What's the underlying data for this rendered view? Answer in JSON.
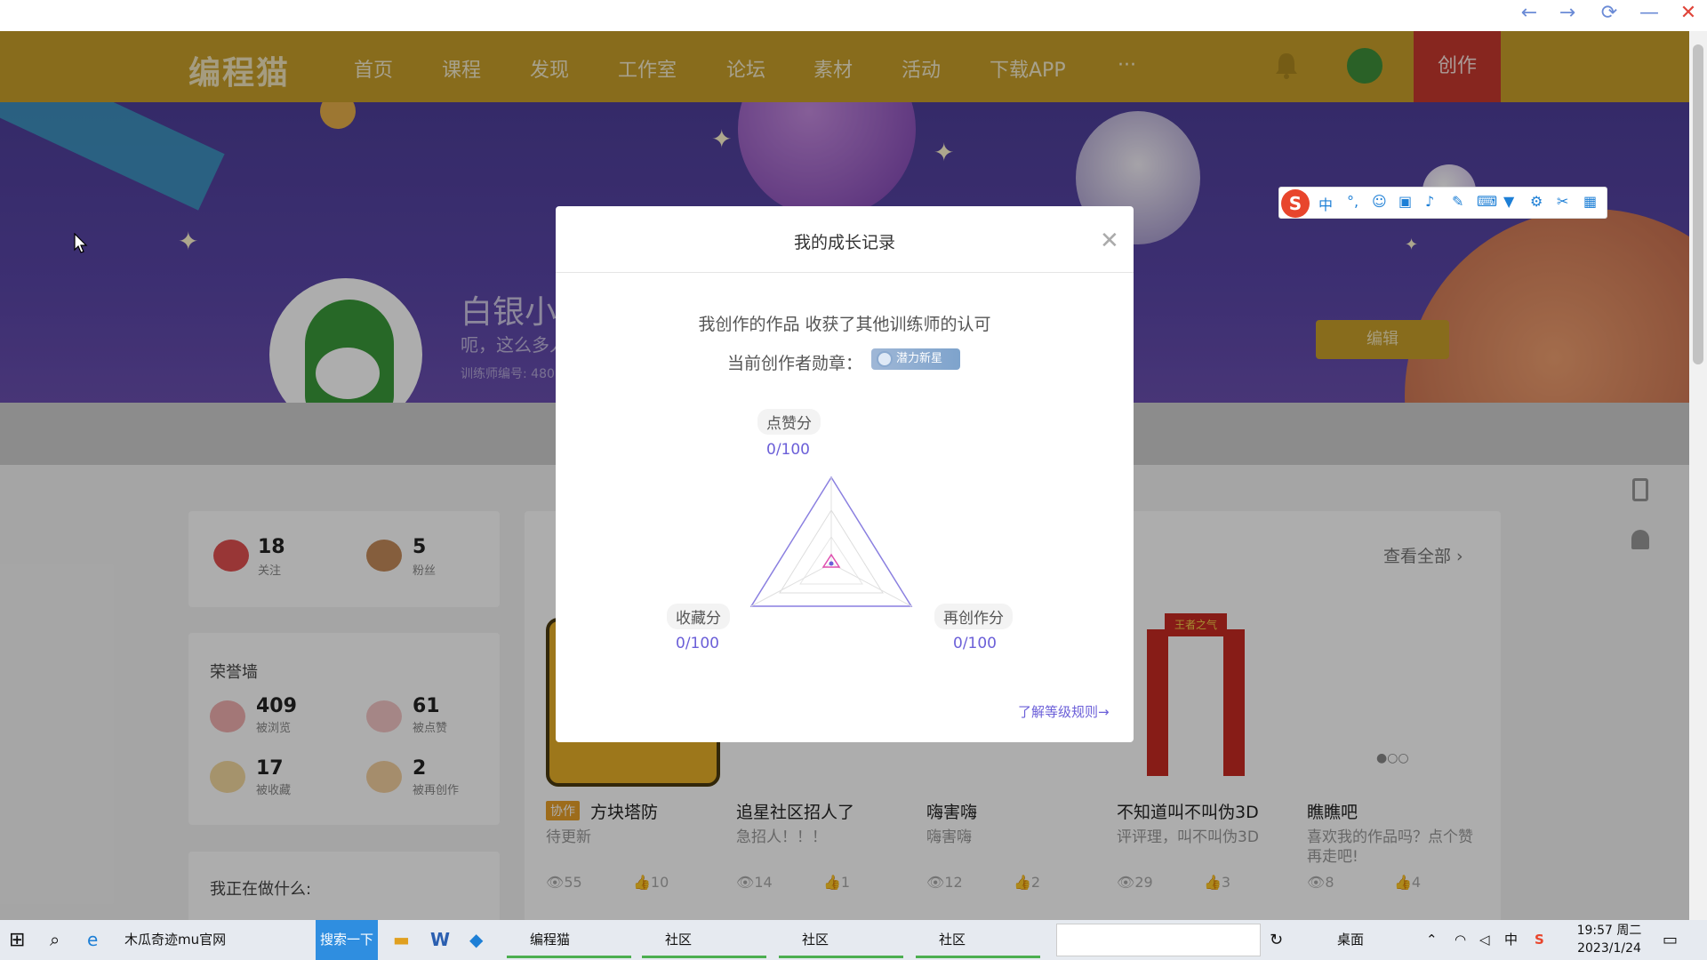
{
  "browser": {
    "back": "←",
    "forward": "→",
    "refresh": "⟳",
    "minimize": "—",
    "close": "✕"
  },
  "nav": {
    "logo": "编程猫",
    "items": [
      "首页",
      "课程",
      "发现",
      "工作室",
      "论坛",
      "素材",
      "活动",
      "下载APP",
      "···"
    ],
    "create": "创作"
  },
  "profile": {
    "name": "白银小弟",
    "subtitle": "呃，这么多人",
    "id_label": "训练师编号: 480",
    "edit": "编辑"
  },
  "stats": {
    "follow": {
      "num": "18",
      "label": "关注"
    },
    "fans": {
      "num": "5",
      "label": "粉丝"
    }
  },
  "honor": {
    "title": "荣誉墙",
    "items": [
      {
        "num": "409",
        "label": "被浏览"
      },
      {
        "num": "61",
        "label": "被点赞"
      },
      {
        "num": "17",
        "label": "被收藏"
      },
      {
        "num": "2",
        "label": "被再创作"
      }
    ]
  },
  "doing": {
    "title": "我正在做什么:"
  },
  "works": {
    "view_all": "查看全部",
    "items": [
      {
        "tag": "协作",
        "title": "方块塔防",
        "sub": "待更新",
        "views": "55",
        "likes": "10"
      },
      {
        "title": "追星社区招人了",
        "sub": "急招人！！！",
        "views": "14",
        "likes": "1"
      },
      {
        "title": "嗨害嗨",
        "sub": "嗨害嗨",
        "views": "12",
        "likes": "2"
      },
      {
        "title": "不知道叫不叫伪3D",
        "sub": "评评理，叫不叫伪3D",
        "views": "29",
        "likes": "3"
      },
      {
        "title": "瞧瞧吧",
        "sub": "喜欢我的作品吗？点个赞",
        "sub2": "再走吧!",
        "views": "8",
        "likes": "4"
      }
    ],
    "poster_text": "王者之气"
  },
  "modal": {
    "title": "我的成长记录",
    "line1": "我创作的作品 收获了其他训练师的认可",
    "line2": "当前创作者勋章：",
    "badge": "潜力新星",
    "radar": {
      "top": {
        "label": "点赞分",
        "value": "0/100"
      },
      "left": {
        "label": "收藏分",
        "value": "0/100"
      },
      "right": {
        "label": "再创作分",
        "value": "0/100"
      }
    },
    "rules": "了解等级规则→"
  },
  "ime": {
    "s": "S",
    "lang": "中"
  },
  "taskbar": {
    "search_text": "木瓜奇迹mu官网",
    "search_btn": "搜索一下",
    "apps": [
      "编程猫",
      "社区",
      "社区",
      "社区"
    ],
    "desktop": "桌面",
    "time": "19:57 周二",
    "date": "2023/1/24"
  }
}
